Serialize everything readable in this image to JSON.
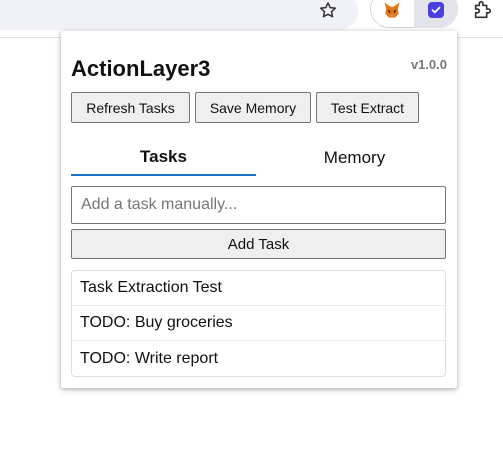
{
  "browser": {
    "icons": [
      "star-icon",
      "metamask-fox-icon",
      "actionlayer-extension-icon",
      "puzzle-icon"
    ]
  },
  "popup": {
    "title": "ActionLayer3",
    "version": "v1.0.0",
    "toolbar": {
      "refresh_label": "Refresh Tasks",
      "save_label": "Save Memory",
      "test_label": "Test Extract"
    },
    "tabs": [
      {
        "label": "Tasks",
        "active": true
      },
      {
        "label": "Memory",
        "active": false
      }
    ],
    "task_input": {
      "placeholder": "Add a task manually...",
      "value": ""
    },
    "add_task_label": "Add Task",
    "tasks": [
      {
        "text": "Task Extraction Test"
      },
      {
        "text": "TODO: Buy groceries"
      },
      {
        "text": "TODO: Write report"
      }
    ]
  },
  "colors": {
    "accent": "#1a73c9",
    "extension_icon": "#4a3fe0",
    "button_bg": "#efefef"
  }
}
